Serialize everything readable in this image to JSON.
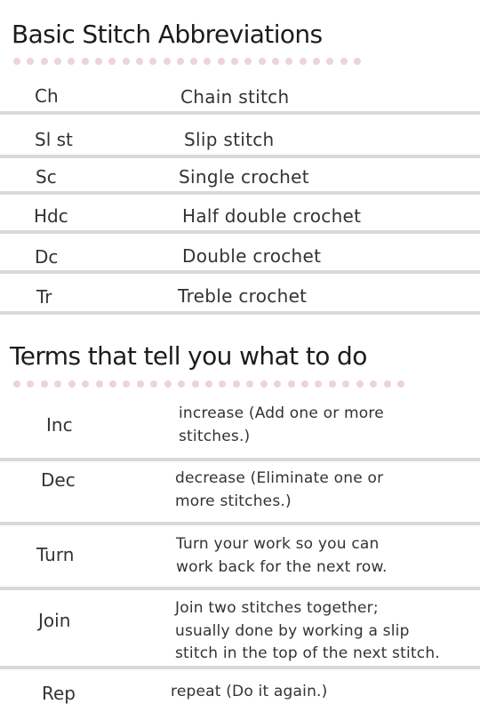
{
  "sections": [
    {
      "title": "Basic Stitch Abbreviations",
      "rows": [
        {
          "term": "Ch",
          "definition": "Chain stitch"
        },
        {
          "term": "Sl st",
          "definition": "Slip stitch"
        },
        {
          "term": "Sc",
          "definition": "Single crochet"
        },
        {
          "term": "Hdc",
          "definition": "Half double crochet"
        },
        {
          "term": "Dc",
          "definition": "Double crochet"
        },
        {
          "term": "Tr",
          "definition": "Treble crochet"
        }
      ]
    },
    {
      "title": "Terms that tell you what to do",
      "rows": [
        {
          "term": "Inc",
          "definition_lines": [
            "increase (Add one or more",
            "stitches.)"
          ]
        },
        {
          "term": "Dec",
          "definition_lines": [
            "decrease (Eliminate one or",
            "more stitches.)"
          ]
        },
        {
          "term": "Turn",
          "definition_lines": [
            "Turn your work so you can",
            "work back for the next row."
          ]
        },
        {
          "term": "Join",
          "definition_lines": [
            "Join two stitches together;",
            "usually done by working a slip",
            "stitch in the top of the next stitch."
          ]
        },
        {
          "term": "Rep",
          "definition_lines": [
            "repeat (Do it again.)"
          ]
        }
      ]
    }
  ],
  "colors": {
    "dot": "#ecd3dc",
    "divider": "#d9d9d9",
    "title": "#1c1c1c",
    "text": "#333333"
  }
}
